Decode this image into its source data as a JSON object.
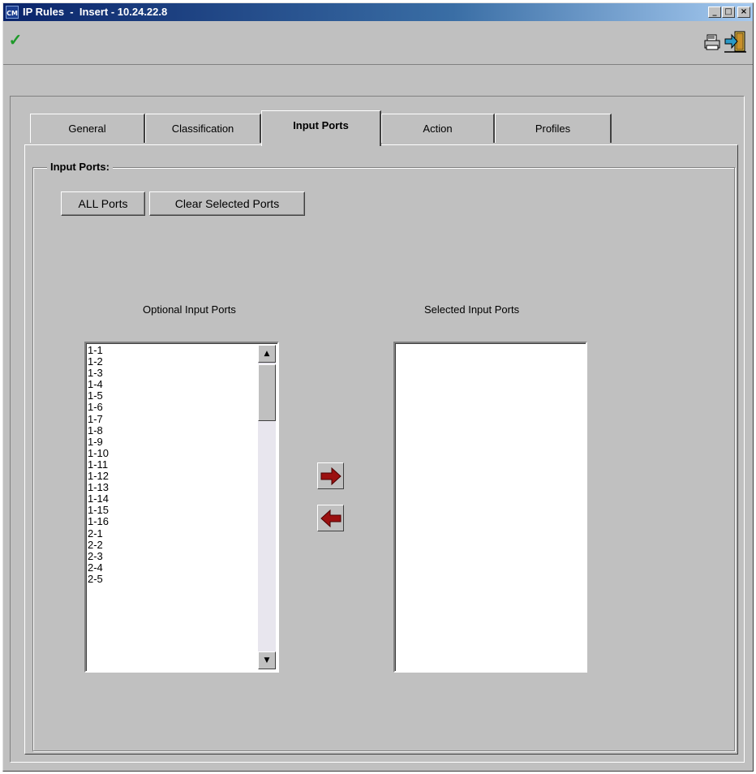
{
  "window": {
    "title": "IP Rules  -  Insert - 10.24.22.8",
    "app_icon_text": "CM",
    "minimize_glyph": "_",
    "maximize_glyph": "□",
    "close_glyph": "×"
  },
  "toolbar": {
    "apply_icon": "check-icon",
    "print_icon": "printer-icon",
    "exit_icon": "exit-door-icon"
  },
  "tabs": [
    {
      "label": "General"
    },
    {
      "label": "Classification"
    },
    {
      "label": "Input Ports"
    },
    {
      "label": "Action"
    },
    {
      "label": "Profiles"
    }
  ],
  "active_tab": "Input Ports",
  "group": {
    "label": "Input Ports:",
    "all_ports_button": "ALL Ports",
    "clear_button": "Clear Selected Ports"
  },
  "optional": {
    "label": "Optional Input Ports",
    "items": [
      "1-1",
      "1-2",
      "1-3",
      "1-4",
      "1-5",
      "1-6",
      "1-7",
      "1-8",
      "1-9",
      "1-10",
      "1-11",
      "1-12",
      "1-13",
      "1-14",
      "1-15",
      "1-16",
      "2-1",
      "2-2",
      "2-3",
      "2-4",
      "2-5"
    ]
  },
  "selected": {
    "label": "Selected Input Ports",
    "items": []
  },
  "arrow_colors": {
    "fill": "#9b1010"
  }
}
